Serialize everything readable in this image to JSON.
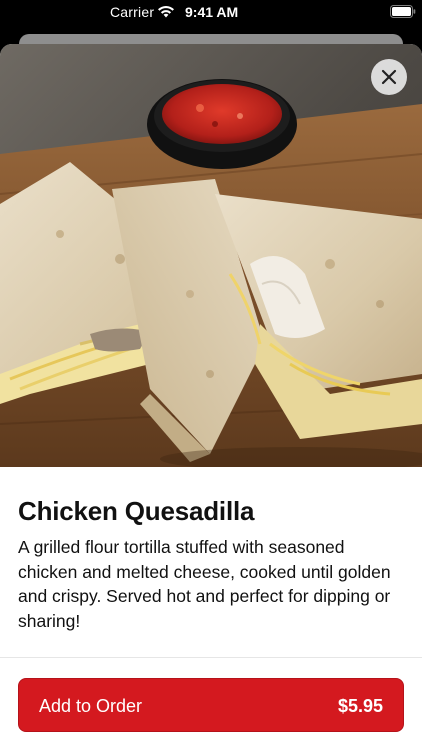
{
  "status_bar": {
    "carrier": "Carrier",
    "time": "9:41 AM",
    "wifi_icon": "wifi-icon",
    "battery_icon": "battery-icon"
  },
  "item": {
    "image_alt_icon": "food-photo",
    "title": "Chicken Quesadilla",
    "description": "A grilled flour tortilla stuffed with seasoned chicken and melted cheese, cooked until golden and crispy. Served hot and perfect for dipping or sharing!"
  },
  "close_icon": "close-icon",
  "order_button": {
    "label": "Add to Order",
    "price": "$5.95"
  },
  "colors": {
    "accent": "#d4191f",
    "text": "#111111"
  }
}
